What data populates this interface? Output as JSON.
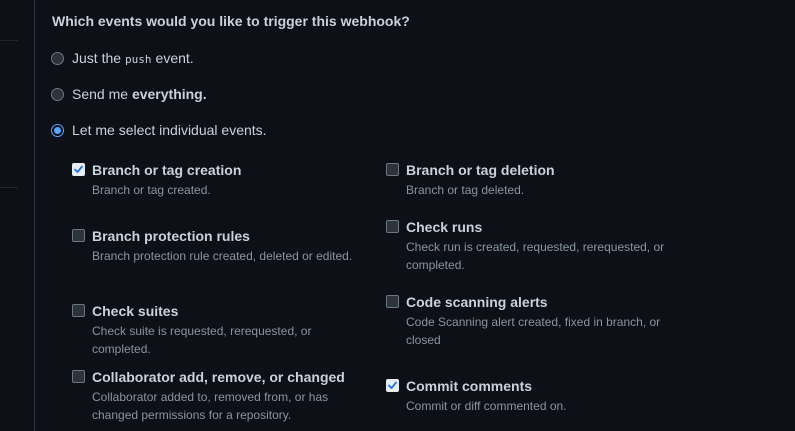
{
  "heading": "Which events would you like to trigger this webhook?",
  "options": {
    "push": {
      "prefix": "Just the",
      "code": "push",
      "suffix": "event."
    },
    "everything": {
      "prefix": "Send me",
      "bold": "everything."
    },
    "individual": {
      "label": "Let me select individual events."
    },
    "selected": "individual"
  },
  "events": [
    {
      "label": "Branch or tag creation",
      "desc": "Branch or tag created.",
      "checked": true
    },
    {
      "label": "Branch or tag deletion",
      "desc": "Branch or tag deleted.",
      "checked": false
    },
    {
      "label": "Branch protection rules",
      "desc": "Branch protection rule created, deleted or edited.",
      "checked": false
    },
    {
      "label": "Check runs",
      "desc": "Check run is created, requested, rerequested, or completed.",
      "checked": false
    },
    {
      "label": "Check suites",
      "desc": "Check suite is requested, rerequested, or completed.",
      "checked": false
    },
    {
      "label": "Code scanning alerts",
      "desc": "Code Scanning alert created, fixed in branch, or closed",
      "checked": false
    },
    {
      "label": "Collaborator add, remove, or changed",
      "desc": "Collaborator added to, removed from, or has changed permissions for a repository.",
      "checked": false
    },
    {
      "label": "Commit comments",
      "desc": "Commit or diff commented on.",
      "checked": true
    }
  ],
  "colors": {
    "background": "#0d1117",
    "accent": "#58a6ff",
    "text": "#c9d1d9",
    "muted": "#8b949e"
  }
}
